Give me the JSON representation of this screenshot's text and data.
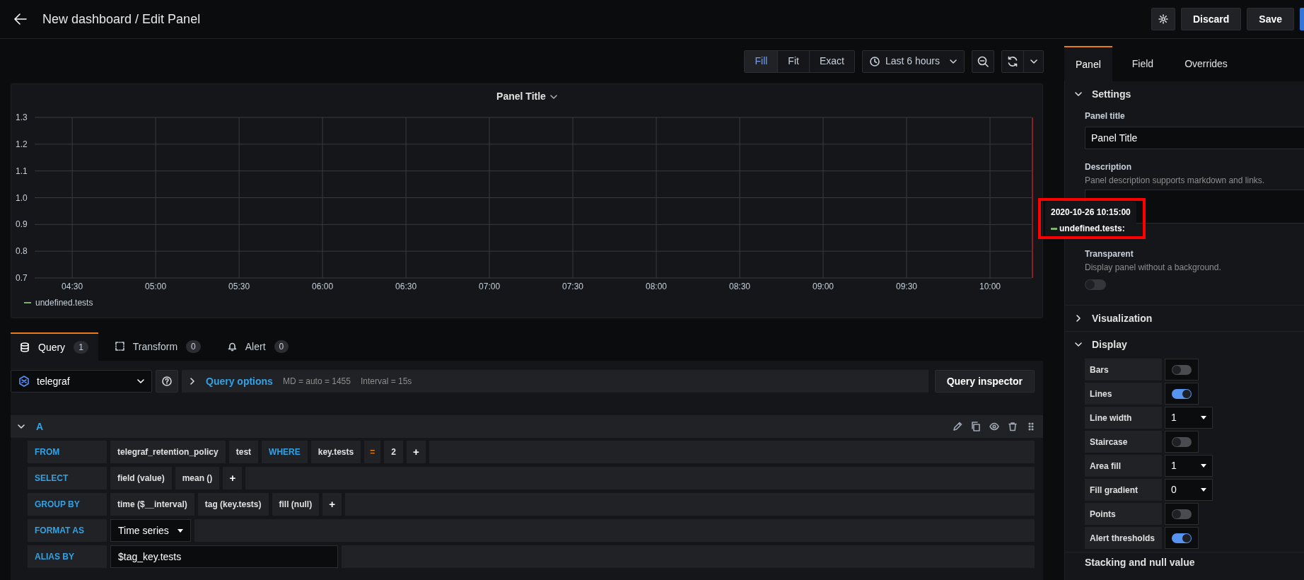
{
  "header": {
    "title": "New dashboard / Edit Panel",
    "buttons": [
      {
        "label": "Discard",
        "kind": "secondary"
      },
      {
        "label": "Save",
        "kind": "secondary"
      },
      {
        "kind": "primary"
      }
    ]
  },
  "toolbar": {
    "size_modes": [
      {
        "label": "Fill",
        "selected": true
      },
      {
        "label": "Fit",
        "selected": false
      },
      {
        "label": "Exact",
        "selected": false
      }
    ],
    "time_range": "Last 6 hours"
  },
  "panel": {
    "title": "Panel Title",
    "chart_data": {
      "type": "line",
      "categories": [
        "04:30",
        "05:00",
        "05:30",
        "06:00",
        "06:30",
        "07:00",
        "07:30",
        "08:00",
        "08:30",
        "09:00",
        "09:30",
        "10:00"
      ],
      "yticks": [
        {
          "value": 0.7,
          "label": "0.7"
        },
        {
          "value": 0.8,
          "label": "0.8"
        },
        {
          "value": 0.9,
          "label": "0.9"
        },
        {
          "value": 1,
          "label": "1.0"
        },
        {
          "value": 1.1,
          "label": "1.1"
        },
        {
          "value": 1.2,
          "label": "1.2"
        },
        {
          "value": 1.3,
          "label": "1.3"
        }
      ],
      "ylim": [
        0.7,
        1.3
      ],
      "grid": true,
      "series": [
        {
          "name": "undefined.tests",
          "color": "#7eb26d",
          "values": [
            null,
            null,
            null,
            null,
            null,
            null,
            null,
            null,
            null,
            null,
            null,
            null
          ]
        }
      ]
    },
    "tooltip": {
      "time": "2020-10-26 10:15:00",
      "series": "undefined.tests:",
      "color": "#7eb26d"
    }
  },
  "query_tabs": [
    {
      "label": "Query",
      "count": "1",
      "kind": "database",
      "selected": true
    },
    {
      "label": "Transform",
      "count": "0",
      "kind": "transform",
      "selected": false
    },
    {
      "label": "Alert",
      "count": "0",
      "kind": "bell",
      "selected": false
    }
  ],
  "datasource": "telegraf",
  "query_options": {
    "label": "Query options",
    "md": "MD = auto = 1455",
    "interval": "Interval = 15s"
  },
  "query_inspector": "Query inspector",
  "query": {
    "ref": "A",
    "expanded": true,
    "rows": [
      {
        "label": "FROM",
        "parts": [
          {
            "text": "telegraf_retention_policy",
            "kind": "segment"
          },
          {
            "text": "test",
            "kind": "segment"
          },
          {
            "text": "WHERE",
            "kind": "keyword"
          },
          {
            "text": "key.tests",
            "kind": "segment"
          },
          {
            "text": "=",
            "kind": "operator"
          },
          {
            "text": "2",
            "kind": "segment"
          },
          {
            "text": "+",
            "kind": "plus"
          }
        ]
      },
      {
        "label": "SELECT",
        "parts": [
          {
            "text": "field (value)",
            "kind": "segment"
          },
          {
            "text": "mean ()",
            "kind": "segment"
          },
          {
            "text": "+",
            "kind": "plus"
          }
        ]
      },
      {
        "label": "GROUP BY",
        "parts": [
          {
            "text": "time ($__interval)",
            "kind": "segment"
          },
          {
            "text": "tag (key.tests)",
            "kind": "segment"
          },
          {
            "text": "fill (null)",
            "kind": "segment"
          },
          {
            "text": "+",
            "kind": "plus"
          }
        ]
      },
      {
        "label": "FORMAT AS",
        "parts": [
          {
            "text": "Time series",
            "kind": "select"
          }
        ]
      },
      {
        "label": "ALIAS BY",
        "parts": [
          {
            "text": "$tag_key.tests",
            "kind": "input"
          }
        ]
      }
    ]
  },
  "options_tabs": [
    {
      "label": "Panel",
      "selected": true
    },
    {
      "label": "Field",
      "selected": false
    },
    {
      "label": "Overrides",
      "selected": false
    }
  ],
  "settings": {
    "title": "Settings",
    "expanded": true,
    "panel_title_label": "Panel title",
    "panel_title_value": "Panel Title",
    "description_label": "Description",
    "description_help": "Panel description supports markdown and links.",
    "transparent_label": "Transparent",
    "transparent_help": "Display panel without a background.",
    "transparent_on": false
  },
  "sections": [
    {
      "title": "Visualization",
      "expanded": false
    },
    {
      "title": "Display",
      "expanded": true
    }
  ],
  "display": [
    {
      "label": "Bars",
      "kind": "toggle",
      "on": false
    },
    {
      "label": "Lines",
      "kind": "toggle",
      "on": true
    },
    {
      "label": "Line width",
      "kind": "select",
      "value": "1"
    },
    {
      "label": "Staircase",
      "kind": "toggle",
      "on": false
    },
    {
      "label": "Area fill",
      "kind": "select",
      "value": "1"
    },
    {
      "label": "Fill gradient",
      "kind": "select",
      "value": "0"
    },
    {
      "label": "Points",
      "kind": "toggle",
      "on": false
    },
    {
      "label": "Alert thresholds",
      "kind": "toggle",
      "on": true
    }
  ],
  "next_section": "Stacking and null value"
}
